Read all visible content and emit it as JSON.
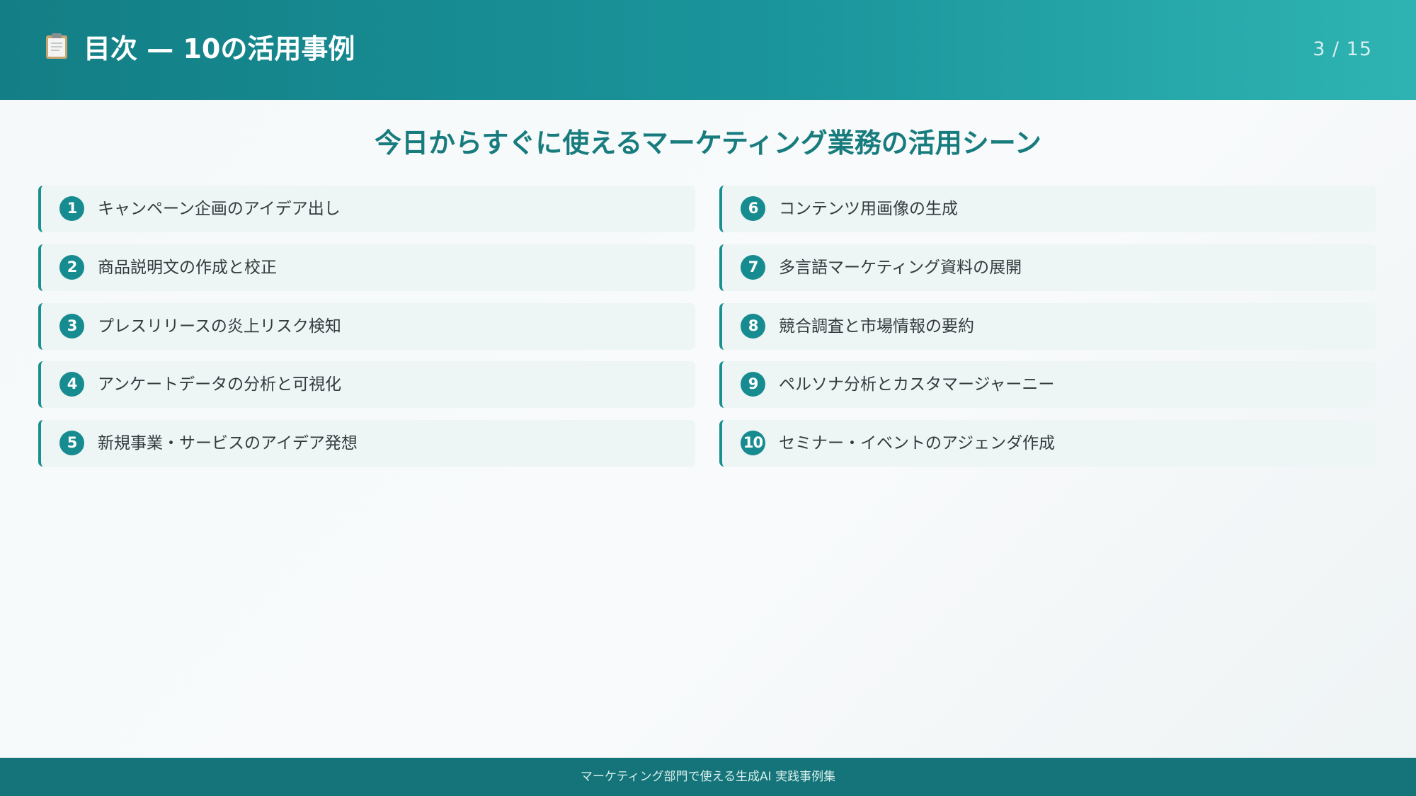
{
  "header": {
    "icon": "clipboard-icon",
    "title": "目次 — 10の活用事例",
    "page_indicator": "3 / 15"
  },
  "subtitle": "今日からすぐに使えるマーケティング業務の活用シーン",
  "items": [
    {
      "number": "1",
      "label": "キャンペーン企画のアイデア出し"
    },
    {
      "number": "2",
      "label": "商品説明文の作成と校正"
    },
    {
      "number": "3",
      "label": "プレスリリースの炎上リスク検知"
    },
    {
      "number": "4",
      "label": "アンケートデータの分析と可視化"
    },
    {
      "number": "5",
      "label": "新規事業・サービスのアイデア発想"
    },
    {
      "number": "6",
      "label": "コンテンツ用画像の生成"
    },
    {
      "number": "7",
      "label": "多言語マーケティング資料の展開"
    },
    {
      "number": "8",
      "label": "競合調査と市場情報の要約"
    },
    {
      "number": "9",
      "label": "ペルソナ分析とカスタマージャーニー"
    },
    {
      "number": "10",
      "label": "セミナー・イベントのアジェンダ作成"
    }
  ],
  "footer": {
    "text": "マーケティング部門で使える生成AI 実践事例集"
  },
  "colors": {
    "accent": "#178c90",
    "header_start": "#137e85",
    "header_end": "#2fb3b2",
    "footer": "#157479",
    "item_background": "#eef5f5",
    "subtitle": "#187c7e"
  }
}
